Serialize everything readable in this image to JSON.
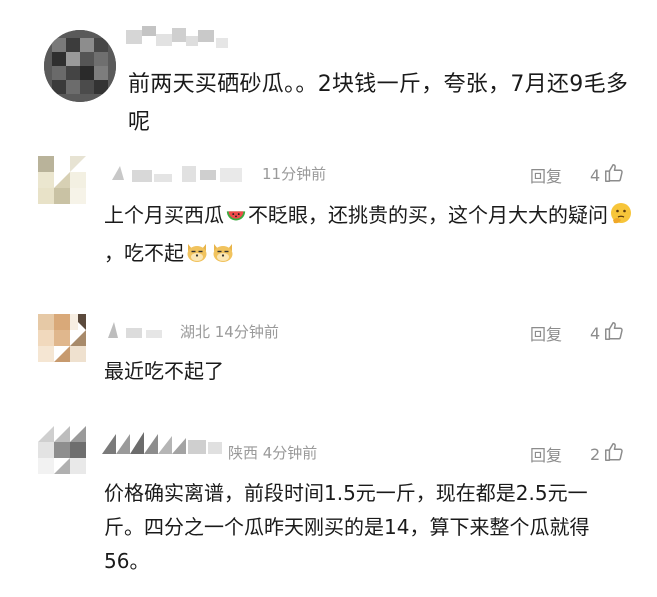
{
  "main_comment": {
    "text": "前两天买硒砂瓜。。2块钱一斤，夸张，7月还9毛多呢"
  },
  "replies": [
    {
      "meta": "11分钟前",
      "reply_label": "回复",
      "likes": "4",
      "text_a": "上个月买西瓜",
      "text_b": "不眨眼，还挑贵的买，这个月大大的疑问",
      "text_c": "，吃不起",
      "emojis": [
        "watermelon-emoji",
        "thinking-face-emoji",
        "doge-emoji",
        "doge-emoji"
      ]
    },
    {
      "meta": "湖北 14分钟前",
      "reply_label": "回复",
      "likes": "4",
      "text": "最近吃不起了"
    },
    {
      "meta": "陕西 4分钟前",
      "reply_label": "回复",
      "likes": "2",
      "text": "价格确实离谱，前段时间1.5元一斤，现在都是2.5元一斤。四分之一个瓜昨天刚买的是14，算下来整个瓜就得56。"
    }
  ],
  "colors": {
    "text": "#1a1a1a",
    "meta": "#9a9a9a",
    "action": "#8c8c8c"
  }
}
